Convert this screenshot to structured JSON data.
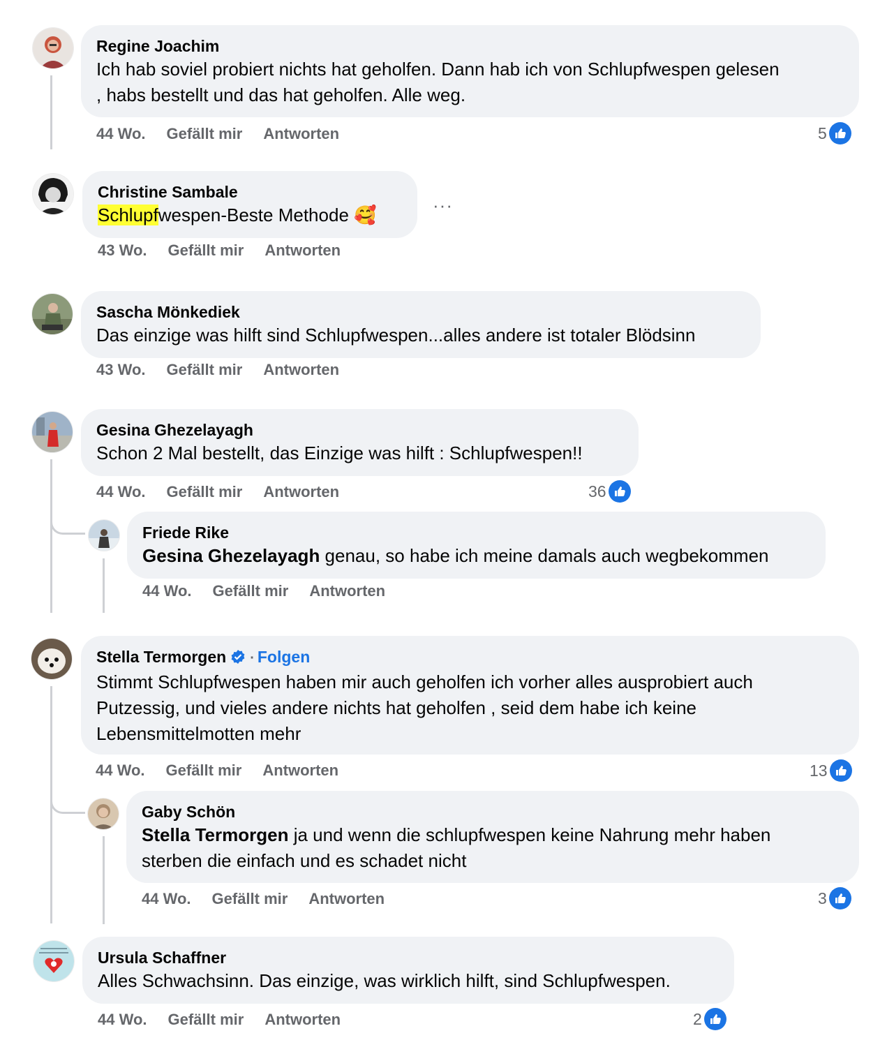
{
  "colors": {
    "like_blue": "#1b74e4",
    "bubble_bg": "#f0f2f5",
    "meta_gray": "#65676b",
    "highlight": "#ffff33"
  },
  "comments": [
    {
      "author": "Regine Joachim",
      "text": "Ich hab soviel probiert nichts hat geholfen. Dann hab ich von Schlupfwespen gelesen\n, habs bestellt und das hat geholfen. Alle weg.",
      "time": "44 Wo.",
      "like_label": "Gefällt mir",
      "reply_label": "Antworten",
      "reactions": "5",
      "reaction_icon": "like-icon"
    },
    {
      "author": "Christine Sambale",
      "text_highlight": "Schlupf",
      "text_rest": "wespen-Beste Methode 🥰",
      "time": "43 Wo.",
      "like_label": "Gefällt mir",
      "reply_label": "Antworten",
      "more_label": "···"
    },
    {
      "author": "Sascha Mönkediek",
      "text": "Das einzige was hilft sind Schlupfwespen...alles andere ist totaler Blödsinn",
      "time": "43 Wo.",
      "like_label": "Gefällt mir",
      "reply_label": "Antworten"
    },
    {
      "author": "Gesina Ghezelayagh",
      "text": "Schon 2 Mal bestellt, das Einzige was hilft : Schlupfwespen!!",
      "time": "44 Wo.",
      "like_label": "Gefällt mir",
      "reply_label": "Antworten",
      "reactions": "36",
      "reaction_icon": "like-icon",
      "reply": {
        "author": "Friede Rike",
        "mention": "Gesina Ghezelayagh",
        "text": " genau, so habe ich meine damals auch wegbekommen",
        "time": "44 Wo.",
        "like_label": "Gefällt mir",
        "reply_label": "Antworten"
      }
    },
    {
      "author": "Stella Termorgen",
      "follow_label": "Folgen",
      "separator": "·",
      "verified_icon": "verified-badge-icon",
      "text": "Stimmt Schlupfwespen haben mir auch geholfen ich vorher alles ausprobiert auch\nPutzessig, und vieles andere nichts hat geholfen , seid dem habe ich keine\nLebensmittelmotten mehr",
      "time": "44 Wo.",
      "like_label": "Gefällt mir",
      "reply_label": "Antworten",
      "reactions": "13",
      "reaction_icon": "like-icon",
      "reply": {
        "author": "Gaby Schön",
        "mention": "Stella Termorgen",
        "text": " ja und wenn die schlupfwespen keine Nahrung mehr haben\nsterben die einfach und es schadet nicht",
        "time": "44 Wo.",
        "like_label": "Gefällt mir",
        "reply_label": "Antworten",
        "reactions": "3",
        "reaction_icon": "like-icon"
      }
    },
    {
      "author": "Ursula Schaffner",
      "text": "Alles Schwachsinn. Das einzige, was wirklich hilft, sind Schlupfwespen.",
      "time": "44 Wo.",
      "like_label": "Gefällt mir",
      "reply_label": "Antworten",
      "reactions": "2",
      "reaction_icon": "like-icon"
    }
  ]
}
